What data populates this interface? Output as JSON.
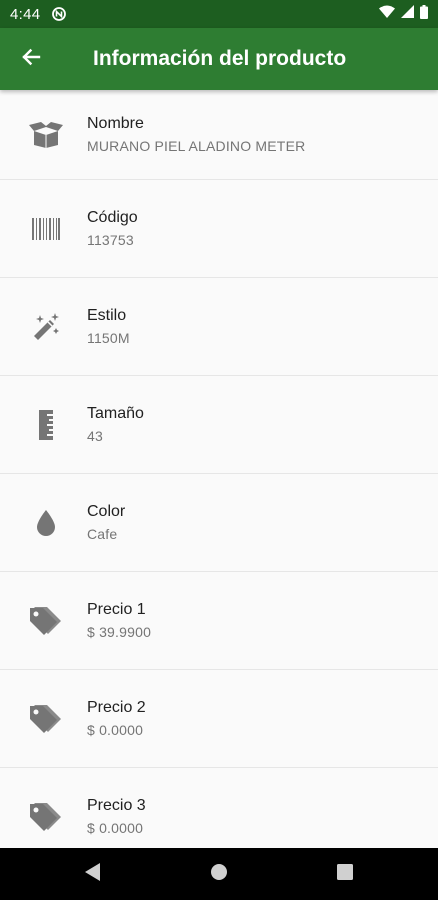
{
  "status_bar": {
    "time": "4:44",
    "icons": [
      "notification-icon",
      "wifi-icon",
      "signal-icon",
      "battery-icon"
    ]
  },
  "app_bar": {
    "title": "Información del producto",
    "back_icon": "arrow-back-icon",
    "color": "#2e7d32"
  },
  "items": [
    {
      "label": "Nombre",
      "value": "MURANO PIEL ALADINO METER",
      "icon": "box-icon"
    },
    {
      "label": "Código",
      "value": "113753",
      "icon": "barcode-icon"
    },
    {
      "label": "Estilo",
      "value": "1150M",
      "icon": "magic-wand-icon"
    },
    {
      "label": "Tamaño",
      "value": "43",
      "icon": "ruler-icon"
    },
    {
      "label": "Color",
      "value": "Cafe",
      "icon": "drop-icon"
    },
    {
      "label": "Precio 1",
      "value": "$ 39.9900",
      "icon": "tags-icon"
    },
    {
      "label": "Precio 2",
      "value": "$ 0.0000",
      "icon": "tags-icon"
    },
    {
      "label": "Precio 3",
      "value": "$ 0.0000",
      "icon": "tags-icon"
    }
  ],
  "nav_bar": {
    "buttons": [
      "back-triangle-icon",
      "home-circle-icon",
      "recents-square-icon"
    ]
  }
}
